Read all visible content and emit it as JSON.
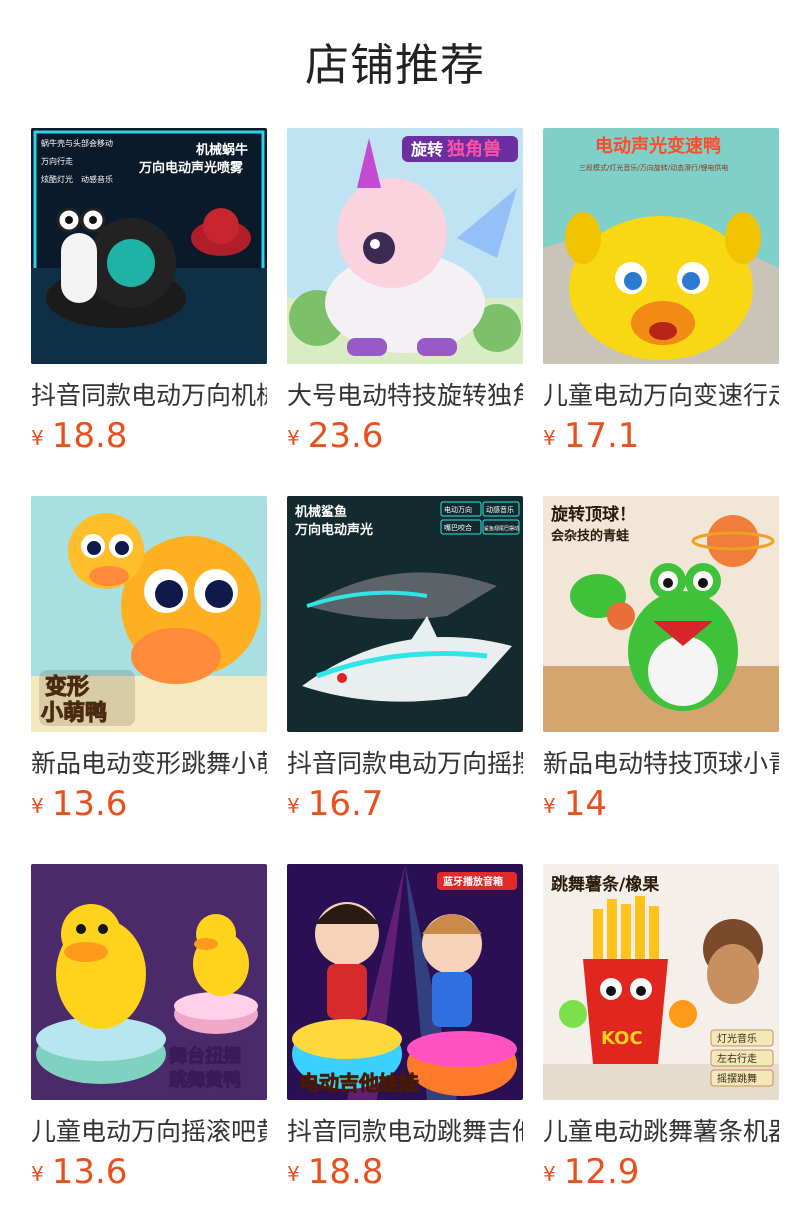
{
  "header": {
    "title": "店铺推荐"
  },
  "currency": "¥",
  "products": [
    {
      "name": "抖音同款电动万向机械蜗牛",
      "price": "18.8",
      "image": {
        "badge": "机械蜗牛",
        "caption": "万向电动声光喷雾",
        "tags": [
          "蜗牛壳与头部会移动",
          "万向行走",
          "炫酷灯光",
          "动感音乐"
        ]
      }
    },
    {
      "name": "大号电动特技旋转独角兽",
      "price": "23.6",
      "image": {
        "badge": "旋转",
        "caption": "独角兽",
        "tags": []
      }
    },
    {
      "name": "儿童电动万向变速行走鸭",
      "price": "17.1",
      "image": {
        "badge": "电动声光变速鸭",
        "caption": "三段模式/灯光音乐/万向旋转/动态滑行/锂电供电",
        "tags": []
      }
    },
    {
      "name": "新品电动变形跳舞小萌鸭",
      "price": "13.6",
      "image": {
        "badge": "变形",
        "caption": "小萌鸭",
        "tags": []
      }
    },
    {
      "name": "抖音同款电动万向摇摆鲨鱼",
      "price": "16.7",
      "image": {
        "badge": "机械鲨鱼",
        "caption": "万向电动声光",
        "tags": [
          "电动万向",
          "动感音乐",
          "嘴巴咬合",
          "鲨鱼翅尾巴摆动"
        ]
      }
    },
    {
      "name": "新品电动特技顶球小青蛙",
      "price": "14",
      "image": {
        "badge": "旋转顶球！",
        "caption": "会杂技的青蛙",
        "tags": []
      }
    },
    {
      "name": "儿童电动万向摇滚吧黄鸭",
      "price": "13.6",
      "image": {
        "badge": "舞台扭摆",
        "caption": "跳舞黄鸭",
        "tags": []
      }
    },
    {
      "name": "抖音同款电动跳舞吉他娃娃",
      "price": "18.8",
      "image": {
        "badge": "蓝牙播放音箱",
        "caption": "电动吉他娃娃",
        "tags": []
      }
    },
    {
      "name": "儿童电动跳舞薯条机器人",
      "price": "12.9",
      "image": {
        "badge": "跳舞薯条/橡果",
        "caption": "KOC",
        "tags": [
          "灯光音乐",
          "左右行走",
          "摇摆跳舞"
        ]
      }
    }
  ],
  "colors": {
    "price": "#e8501d",
    "title": "#222222",
    "name": "#333333"
  }
}
